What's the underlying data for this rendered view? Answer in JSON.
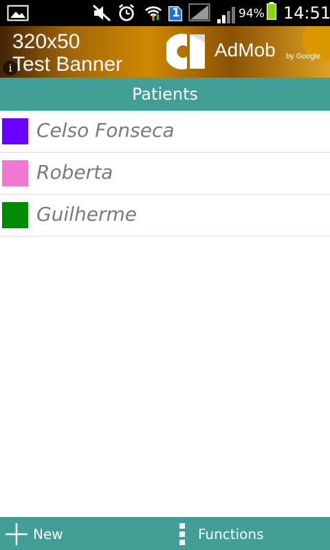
{
  "status_bar": {
    "battery_percent": "94%",
    "time": "14:51",
    "sim_badge": "1",
    "icons": [
      "gallery-icon",
      "mute-icon",
      "alarm-icon",
      "wifi-icon",
      "sim-icon",
      "no-signal-icon",
      "signal-icon",
      "battery-icon"
    ]
  },
  "ad_banner": {
    "line1": "320x50",
    "line2": "Test Banner",
    "info_glyph": "i",
    "brand": "AdMob",
    "brand_byline": "by Google"
  },
  "header": {
    "title": "Patients"
  },
  "patients": [
    {
      "name": "Celso Fonseca",
      "color": "#6a00ff"
    },
    {
      "name": "Roberta",
      "color": "#f078d2"
    },
    {
      "name": "Guilherme",
      "color": "#008a00"
    }
  ],
  "bottom_bar": {
    "new_label": "New",
    "functions_label": "Functions"
  },
  "colors": {
    "accent": "#429f98",
    "status_bar": "#000000",
    "row_text": "#7a7a7a"
  }
}
